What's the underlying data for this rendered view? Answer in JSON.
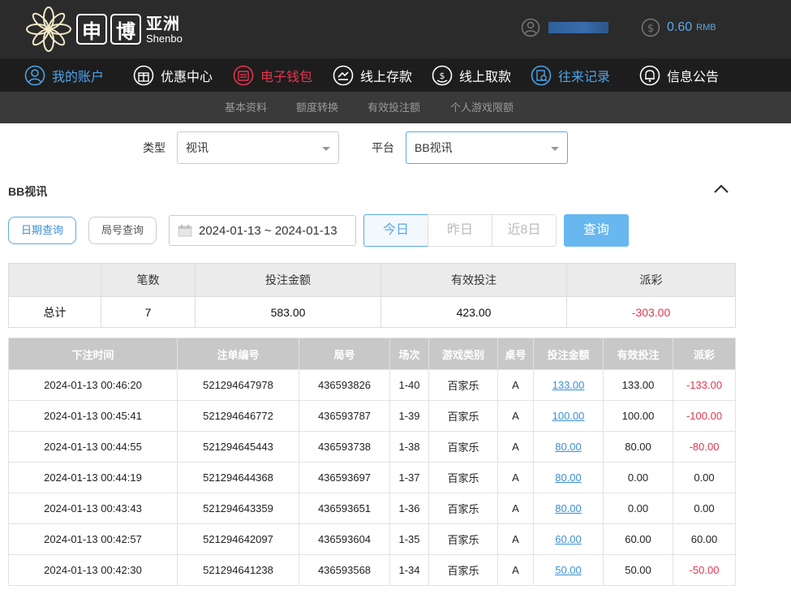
{
  "brand": {
    "char1": "申",
    "char2": "博",
    "cn": "亚洲",
    "en": "Shenbo"
  },
  "account": {
    "balance": "0.60",
    "currency": "RMB"
  },
  "nav": [
    {
      "label": "我的账户",
      "icon": "user-circle-icon"
    },
    {
      "label": "优惠中心",
      "icon": "gift-icon"
    },
    {
      "label": "电子钱包",
      "icon": "wallet-icon"
    },
    {
      "label": "线上存款",
      "icon": "deposit-icon"
    },
    {
      "label": "线上取款",
      "icon": "withdraw-icon"
    },
    {
      "label": "往来记录",
      "icon": "records-icon"
    },
    {
      "label": "信息公告",
      "icon": "bell-icon"
    }
  ],
  "subnav": [
    "基本资料",
    "额度转换",
    "有效投注额",
    "个人游戏限额"
  ],
  "filters": {
    "type_label": "类型",
    "type_value": "视讯",
    "platform_label": "平台",
    "platform_value": "BB视讯"
  },
  "section_title": "BB视讯",
  "query_tabs": {
    "by_date": "日期查询",
    "by_round": "局号查询"
  },
  "date_range": "2024-01-13 ~ 2024-01-13",
  "quick": {
    "today": "今日",
    "yesterday": "昨日",
    "last8": "近8日"
  },
  "query_button": "查询",
  "summary": {
    "headers": [
      "",
      "笔数",
      "投注金额",
      "有效投注",
      "派彩"
    ],
    "row": {
      "label": "总计",
      "count": "7",
      "bet": "583.00",
      "valid": "423.00",
      "payout": "-303.00"
    }
  },
  "detail": {
    "headers": [
      "下注时间",
      "注单编号",
      "局号",
      "场次",
      "游戏类别",
      "桌号",
      "投注金额",
      "有效投注",
      "派彩"
    ],
    "rows": [
      {
        "time": "2024-01-13 00:46:20",
        "order": "521294647978",
        "round": "436593826",
        "session": "1-40",
        "game": "百家乐",
        "table": "A",
        "bet": "133.00",
        "valid": "133.00",
        "payout": "-133.00",
        "neg": true
      },
      {
        "time": "2024-01-13 00:45:41",
        "order": "521294646772",
        "round": "436593787",
        "session": "1-39",
        "game": "百家乐",
        "table": "A",
        "bet": "100.00",
        "valid": "100.00",
        "payout": "-100.00",
        "neg": true
      },
      {
        "time": "2024-01-13 00:44:55",
        "order": "521294645443",
        "round": "436593738",
        "session": "1-38",
        "game": "百家乐",
        "table": "A",
        "bet": "80.00",
        "valid": "80.00",
        "payout": "-80.00",
        "neg": true
      },
      {
        "time": "2024-01-13 00:44:19",
        "order": "521294644368",
        "round": "436593697",
        "session": "1-37",
        "game": "百家乐",
        "table": "A",
        "bet": "80.00",
        "valid": "0.00",
        "payout": "0.00",
        "neg": false
      },
      {
        "time": "2024-01-13 00:43:43",
        "order": "521294643359",
        "round": "436593651",
        "session": "1-36",
        "game": "百家乐",
        "table": "A",
        "bet": "80.00",
        "valid": "0.00",
        "payout": "0.00",
        "neg": false
      },
      {
        "time": "2024-01-13 00:42:57",
        "order": "521294642097",
        "round": "436593604",
        "session": "1-35",
        "game": "百家乐",
        "table": "A",
        "bet": "60.00",
        "valid": "60.00",
        "payout": "60.00",
        "neg": false
      },
      {
        "time": "2024-01-13 00:42:30",
        "order": "521294641238",
        "round": "436593568",
        "session": "1-34",
        "game": "百家乐",
        "table": "A",
        "bet": "50.00",
        "valid": "50.00",
        "payout": "-50.00",
        "neg": true
      }
    ]
  }
}
